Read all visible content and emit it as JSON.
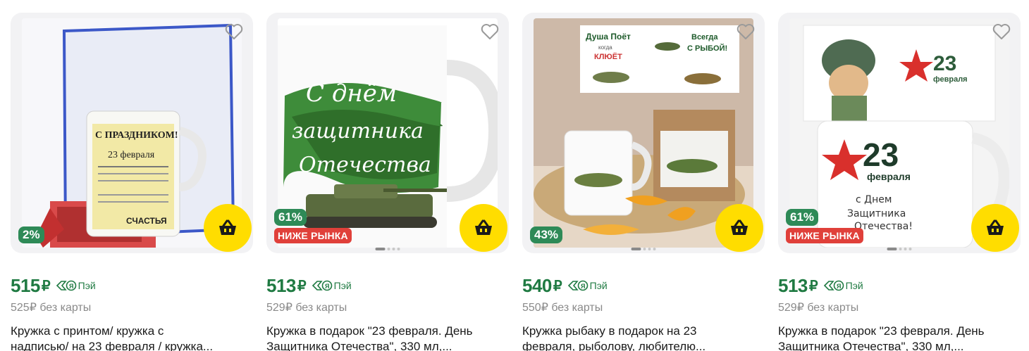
{
  "products": [
    {
      "discount": "2%",
      "market_badge": "",
      "price": "515",
      "currency": "₽",
      "pay_label": "Пэй",
      "old_price": "525₽ без карты",
      "title_line1": "Кружка с принтом/ кружка с",
      "title_line2": "надписью/ на 23 февраля / кружка...",
      "image_text": [
        "С ПРАЗДНИКОМ!",
        "23 февраля",
        "СЧАСТЬЯ"
      ]
    },
    {
      "discount": "61%",
      "market_badge": "НИЖЕ РЫНКА",
      "price": "513",
      "currency": "₽",
      "pay_label": "Пэй",
      "old_price": "529₽ без карты",
      "title_line1": "Кружка в подарок \"23 февраля. День",
      "title_line2": "Защитника Отечества\", 330 мл,...",
      "image_text": [
        "С днём",
        "защитника",
        "Отечества"
      ]
    },
    {
      "discount": "43%",
      "market_badge": "",
      "price": "540",
      "currency": "₽",
      "pay_label": "Пэй",
      "old_price": "550₽ без карты",
      "title_line1": "Кружка рыбаку в подарок на 23",
      "title_line2": "февраля, рыболову, любителю...",
      "image_text": [
        "Душа Поёт",
        "когда",
        "КЛЮЁТ",
        "Всегда",
        "С РЫБОЙ!"
      ]
    },
    {
      "discount": "61%",
      "market_badge": "НИЖЕ РЫНКА",
      "price": "513",
      "currency": "₽",
      "pay_label": "Пэй",
      "old_price": "529₽ без карты",
      "title_line1": "Кружка в подарок \"23 февраля. День",
      "title_line2": "Защитника Отечества\", 330 мл,...",
      "image_text": [
        "23",
        "февраля",
        "с Днем",
        "Защитника",
        "Отечества!"
      ]
    }
  ],
  "colors": {
    "price_green": "#1f7a42",
    "badge_green": "#2e8a57",
    "badge_red": "#e0403a",
    "cart_yellow": "#ffdd00"
  },
  "icons": {
    "favorite": "heart-outline-icon",
    "cart": "basket-icon",
    "pay": "yandex-pay-icon"
  }
}
